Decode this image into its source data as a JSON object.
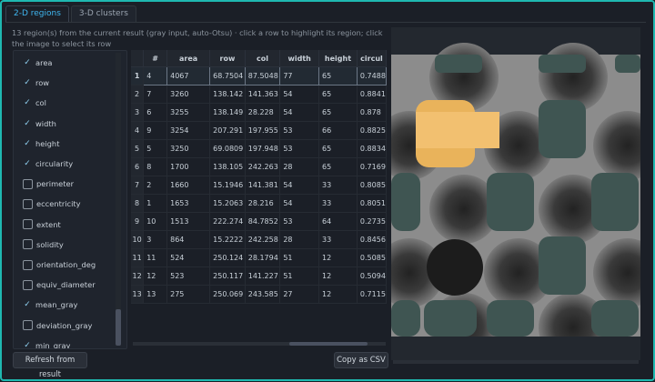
{
  "tabs": [
    {
      "label": "2-D regions",
      "active": true
    },
    {
      "label": "3-D clusters",
      "active": false
    }
  ],
  "description": "13 region(s) from the current result (gray input, auto-Otsu) · click a row to highlight its region; click the image to select its row",
  "columns_list": [
    {
      "label": "area",
      "checked": true
    },
    {
      "label": "row",
      "checked": true
    },
    {
      "label": "col",
      "checked": true
    },
    {
      "label": "width",
      "checked": true
    },
    {
      "label": "height",
      "checked": true
    },
    {
      "label": "circularity",
      "checked": true
    },
    {
      "label": "perimeter",
      "checked": false
    },
    {
      "label": "eccentricity",
      "checked": false
    },
    {
      "label": "extent",
      "checked": false
    },
    {
      "label": "solidity",
      "checked": false
    },
    {
      "label": "orientation_deg",
      "checked": false
    },
    {
      "label": "equiv_diameter",
      "checked": false
    },
    {
      "label": "mean_gray",
      "checked": true
    },
    {
      "label": "deviation_gray",
      "checked": false
    },
    {
      "label": "min_gray",
      "checked": true
    }
  ],
  "table": {
    "headers": [
      "#",
      "area",
      "row",
      "col",
      "width",
      "height",
      "circul"
    ],
    "rows": [
      [
        "4",
        "4067",
        "68.7504",
        "87.5048",
        "77",
        "65",
        "0.7488"
      ],
      [
        "7",
        "3260",
        "138.142",
        "141.363",
        "54",
        "65",
        "0.8841"
      ],
      [
        "6",
        "3255",
        "138.149",
        "28.228",
        "54",
        "65",
        "0.878"
      ],
      [
        "9",
        "3254",
        "207.291",
        "197.955",
        "53",
        "66",
        "0.8825"
      ],
      [
        "5",
        "3250",
        "69.0809",
        "197.948",
        "53",
        "65",
        "0.8834"
      ],
      [
        "8",
        "1700",
        "138.105",
        "242.263",
        "28",
        "65",
        "0.7169"
      ],
      [
        "2",
        "1660",
        "15.1946",
        "141.381",
        "54",
        "33",
        "0.8085"
      ],
      [
        "1",
        "1653",
        "15.2063",
        "28.216",
        "54",
        "33",
        "0.8051"
      ],
      [
        "10",
        "1513",
        "222.274",
        "84.7852",
        "53",
        "64",
        "0.2735"
      ],
      [
        "3",
        "864",
        "15.2222",
        "242.258",
        "28",
        "33",
        "0.8456"
      ],
      [
        "11",
        "524",
        "250.124",
        "28.1794",
        "51",
        "12",
        "0.5085"
      ],
      [
        "12",
        "523",
        "250.117",
        "141.227",
        "51",
        "12",
        "0.5094"
      ],
      [
        "13",
        "275",
        "250.069",
        "243.585",
        "27",
        "12",
        "0.7115"
      ]
    ]
  },
  "buttons": {
    "refresh": "Refresh from result",
    "copy": "Copy as CSV"
  },
  "colors": {
    "accent": "#1fb8b0",
    "tab_active": "#3fb6f0",
    "highlight": "#f2b860"
  }
}
